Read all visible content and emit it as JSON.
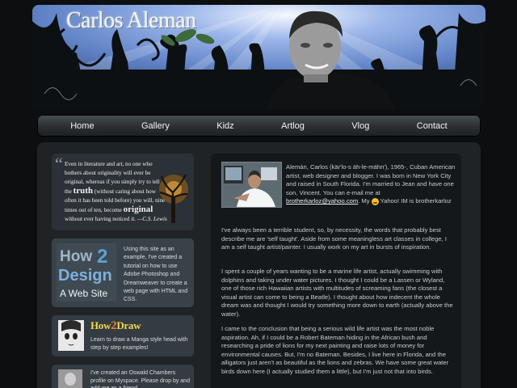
{
  "header": {
    "site_title": "Carlos Aleman"
  },
  "nav": {
    "items": [
      {
        "label": "Home"
      },
      {
        "label": "Gallery"
      },
      {
        "label": "Kidz"
      },
      {
        "label": "Artlog"
      },
      {
        "label": "Vlog"
      },
      {
        "label": "Contact"
      }
    ]
  },
  "sidebar": {
    "quote": {
      "line_a": "Even in literature and art, no one who bothers about originality will ever be original, whereas if you simply try to tell the ",
      "word_truth": "truth",
      "line_b": " (without caring about how often it has been told before) you will, nine times out of ten, become ",
      "word_original": "original",
      "line_c": " without ever having noticed it.",
      "author": "—C.S. Lewis"
    },
    "how2design": {
      "logo_top": "How",
      "logo_two": "2",
      "logo_design": "Design",
      "logo_bottom": "A Web Site",
      "text": "Using this site as an example, I've created a tutorial on how to use Adobe Photoshop and Dreamweaver to create a web page with HTML and CSS."
    },
    "how2draw": {
      "title_a": "How",
      "title_two": "2",
      "title_b": "Draw",
      "text": "Learn to draw a Manga style head with step by step examples!"
    },
    "chambers": {
      "text": "I've created an Oswald Chambers profile on Myspace. Please drop by and add me as a friend."
    }
  },
  "content": {
    "intro_before_email": "Alemán, Carlos (kär'lo-s äh-le-mähn'), 1965-, Cuban American artist, web designer and blogger. I was born in New York City and raised in South Florida. I'm married to Jean and have one son, Vincent. You can e-mail me at ",
    "email": "brotherkarloz@yahoo.com",
    "intro_after_email": ". My ",
    "im_label": " Yahoo! IM is brotherkarloz",
    "p2": "I've always been a terrible student, so, by necessity, the words that probably best describe me are 'self taught'. Aside from some meaningless art classes in college, I am a self taught artist/painter. I usually work on my art in bursts of inspiration.",
    "p3": "I spent a couple of years wanting to be a marine life artist, actually swimming with dolphins and taking under water pictures. I thought I could be a Lassen or Wyland, one of those rich Hawaiian artists with multitudes of screaming fans (the closest a visual artist can come to being a Beatle). I thought about how indecent the whole dream was and thought I would try something more down to earth (actually above the water).",
    "p4": "I came to the conclusion that being a serious wild life artist was the most noble aspiration. Ah, if I could be a Robert Bateman hiding in the African bush and researching a pride of lions for my next painting and raise lots of money for environmental causes. But, I'm no Bateman. Besides, I live here in Florida, and the alligators just aren't as beautiful as the lions and zebras. We have some great water birds down here (I actually studied them a little), but I'm just not that into birds."
  }
}
